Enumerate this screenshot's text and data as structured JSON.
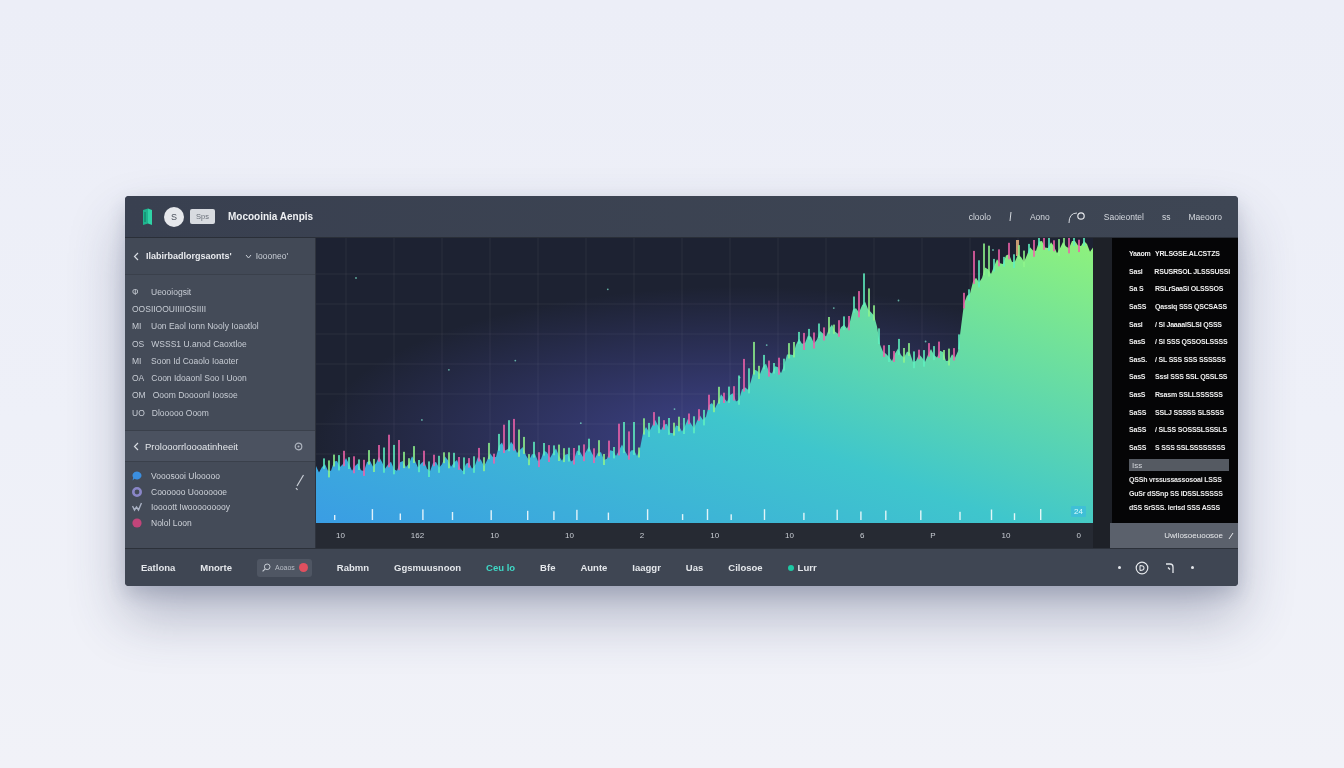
{
  "header": {
    "badge": "S",
    "tag": "Sps",
    "title": "Mocooinia Aenpis",
    "nav": [
      "cloolo",
      "Aono",
      "Saoieontel",
      "ss",
      "Maeooro"
    ]
  },
  "sidebar": {
    "title": "Ilabirbadlorgsaonts'",
    "filter": "Ioooneo'",
    "items": [
      {
        "code": "Ф",
        "label": "Ueooiogsit"
      },
      {
        "label": "OOSIIOOUIIIIOSIIII"
      },
      {
        "code": "MI",
        "label": "Uon Eaol Ionn Nooly Ioaotlol"
      },
      {
        "code": "OS",
        "label": "WSSS1 U.anod Caoxtloe"
      },
      {
        "code": "MI",
        "label": "Soon Id Coaolo Ioaoter"
      },
      {
        "code": "OA",
        "label": "Coon Idoaonl Soo I Uoon"
      },
      {
        "code": "OM",
        "label": "Ooom Doooonl Ioosoe"
      },
      {
        "code": "UO",
        "label": "Dlooooo Ooom"
      }
    ],
    "section": "Prolooorrloooatinheeit",
    "contacts": [
      {
        "kind": "bubble",
        "color": "#3b8fe0",
        "label": "Vooosooi Ulooooo"
      },
      {
        "kind": "ring",
        "color": "#8a86c8",
        "label": "Coooooo Uooooooe"
      },
      {
        "kind": "tick",
        "color": "#aab2c4",
        "label": "Ioooott Iwooooooooy"
      },
      {
        "kind": "dot",
        "color": "#c2457a",
        "label": "Nolol Loon"
      }
    ]
  },
  "chart": {
    "value_tag": "24",
    "x_labels": [
      "10",
      "162",
      "10",
      "10",
      "2",
      "10",
      "10",
      "6",
      "P",
      "10",
      "0"
    ]
  },
  "details": {
    "rows": [
      {
        "key": "Yaaom",
        "value": "YRLSGSE.ALCSTZS"
      },
      {
        "key": "Sasl",
        "value": "RSUSRSOL JLSSSUSSI"
      },
      {
        "key": "Sa S",
        "value": "RSLrSaaSl OLSSSOS"
      },
      {
        "key": "SaSS",
        "value": "Qassiq SSS QSCSASS"
      },
      {
        "key": "Sasl",
        "value": "/ Sl JaaaalSLSI QSSS"
      },
      {
        "key": "SasS",
        "value": "/ Sl SSS QSSOSLSSSS"
      },
      {
        "key": "SasS.",
        "value": "/ SL SSS SSS SSSSSS"
      },
      {
        "key": "SasS",
        "value": "Sssl SSS SSL QSSLSS"
      },
      {
        "key": "SasS",
        "value": "Rsasm SSLLSSSSSS"
      },
      {
        "key": "SaSS",
        "value": "SSLJ SSSSS SLSSSS"
      },
      {
        "key": "SaSS",
        "value": "/ SLSS SOSSSLSSSLS"
      },
      {
        "key": "SaSS",
        "value": "S SSS SSLSSSSSSSS"
      }
    ],
    "field": {
      "placeholder": "Iss"
    },
    "notes": [
      "QSSh vrssussassosoai LSSS",
      "GuSr dSSnp SS IDSSLSSSSS",
      "dSS SrSSS. Ierisd SSS ASSS"
    ],
    "button": "Uwllosoeuoosoe"
  },
  "footer": {
    "tabs": [
      {
        "kind": "tab",
        "label": "Eatlona",
        "selected": false
      },
      {
        "kind": "tab",
        "label": "Mnorte",
        "selected": false
      },
      {
        "kind": "chip",
        "label": "Aoaos",
        "color": "#e0505f",
        "selected": false
      },
      {
        "kind": "tab",
        "label": "Rabmn",
        "selected": false
      },
      {
        "kind": "tab",
        "label": "Ggsmuusnoon",
        "selected": false
      },
      {
        "kind": "tab",
        "label": "Ceu lo",
        "selected": true
      },
      {
        "kind": "tab",
        "label": "Bfe",
        "selected": false
      },
      {
        "kind": "tab",
        "label": "Aunte",
        "selected": false
      },
      {
        "kind": "tab",
        "label": "Iaaggr",
        "selected": false
      },
      {
        "kind": "tab",
        "label": "Uas",
        "selected": false
      },
      {
        "kind": "tab",
        "label": "Cilosoe",
        "selected": false
      },
      {
        "kind": "status",
        "label": "Lurr",
        "color": "#1ec9a4",
        "selected": false
      }
    ]
  }
}
